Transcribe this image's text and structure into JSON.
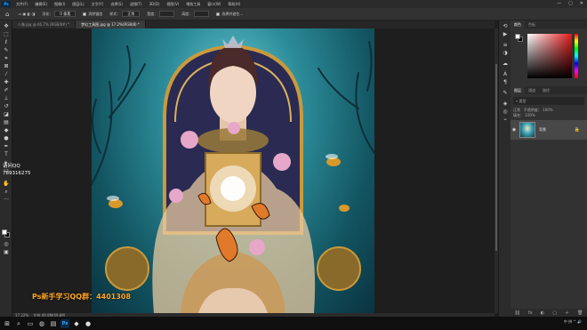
{
  "app": {
    "logo": "Ps"
  },
  "menubar": [
    "文件(F)",
    "编辑(E)",
    "图像(I)",
    "图层(L)",
    "文字(Y)",
    "选择(S)",
    "滤镜(T)",
    "3D(D)",
    "视图(V)",
    "增效工具",
    "窗口(W)",
    "帮助(H)"
  ],
  "window_controls": [
    "—",
    "▢",
    "✕"
  ],
  "options_bar": {
    "home_icon": "home-icon",
    "feather_label": "羽化：",
    "feather_value": "0 像素",
    "antialias_label": "消除锯齿",
    "style_label": "样式：",
    "style_value": "正常",
    "width_label": "宽度：",
    "height_label": "高度：",
    "select_mask_button": "选择并遮住..."
  },
  "tabs": [
    {
      "label": "人像.jpg @ 66.7% (RGB/8#) *",
      "active": false
    },
    {
      "label": "梦幻工具图.jpg @ 17.2%(RGB/8) *",
      "active": true
    }
  ],
  "status": {
    "zoom": "17.22%",
    "doc_info": "文档:49.8M/49.8M"
  },
  "overlay": {
    "qq_lines": [
      "请问QQ",
      "789316275"
    ],
    "group_text": "Ps新手学习QQ群：4401308"
  },
  "panels": {
    "color_tabs": [
      "颜色",
      "色板"
    ],
    "layer_tabs": [
      "图层",
      "通道",
      "路径"
    ],
    "filter_placeholder": "类型",
    "blend_mode": "正常",
    "opacity_label": "不透明度：",
    "opacity_value": "100%",
    "fill_label": "填充：",
    "fill_value": "100%",
    "layer_name": "背景"
  },
  "taskbar": {
    "tray_text": "中  拼  ^ 🔊"
  },
  "colors": {
    "fg": "#ffffff",
    "bg": "#000000",
    "accent_orange": "#ffa826",
    "canvas_teal": "#2c8b98"
  }
}
